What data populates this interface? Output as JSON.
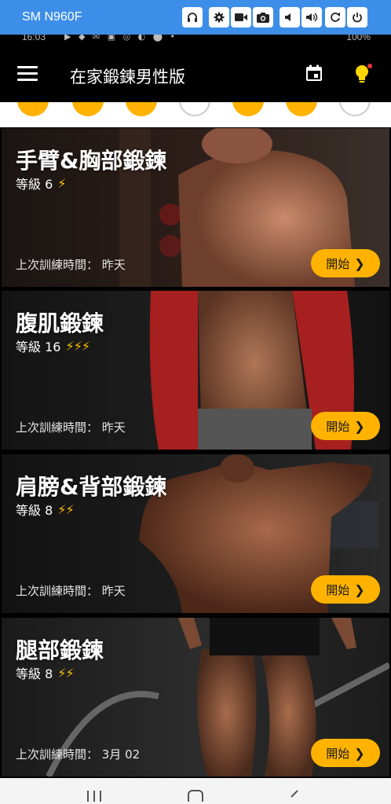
{
  "remote": {
    "device": "SM N960F"
  },
  "status": {
    "time": "16:03",
    "battery": "100%"
  },
  "app": {
    "title": "在家鍛鍊男性版"
  },
  "colors": {
    "accent": "#ffb300",
    "bolt": "#ffc107"
  },
  "cards": [
    {
      "title": "手臂&胸部鍛鍊",
      "level": "等級 6",
      "bolts": "⚡",
      "last": "上次訓練時間： 昨天",
      "start": "開始"
    },
    {
      "title": "腹肌鍛鍊",
      "level": "等級 16",
      "bolts": "⚡⚡⚡",
      "last": "上次訓練時間： 昨天",
      "start": "開始"
    },
    {
      "title": "肩膀&背部鍛鍊",
      "level": "等級 8",
      "bolts": "⚡⚡",
      "last": "上次訓練時間： 昨天",
      "start": "開始"
    },
    {
      "title": "腿部鍛鍊",
      "level": "等級 8",
      "bolts": "⚡⚡",
      "last": "上次訓練時間： 3月 02",
      "start": "開始"
    }
  ],
  "icons": {
    "menu": "menu-icon",
    "calendar": "calendar-icon",
    "tips": "lightbulb-icon"
  }
}
